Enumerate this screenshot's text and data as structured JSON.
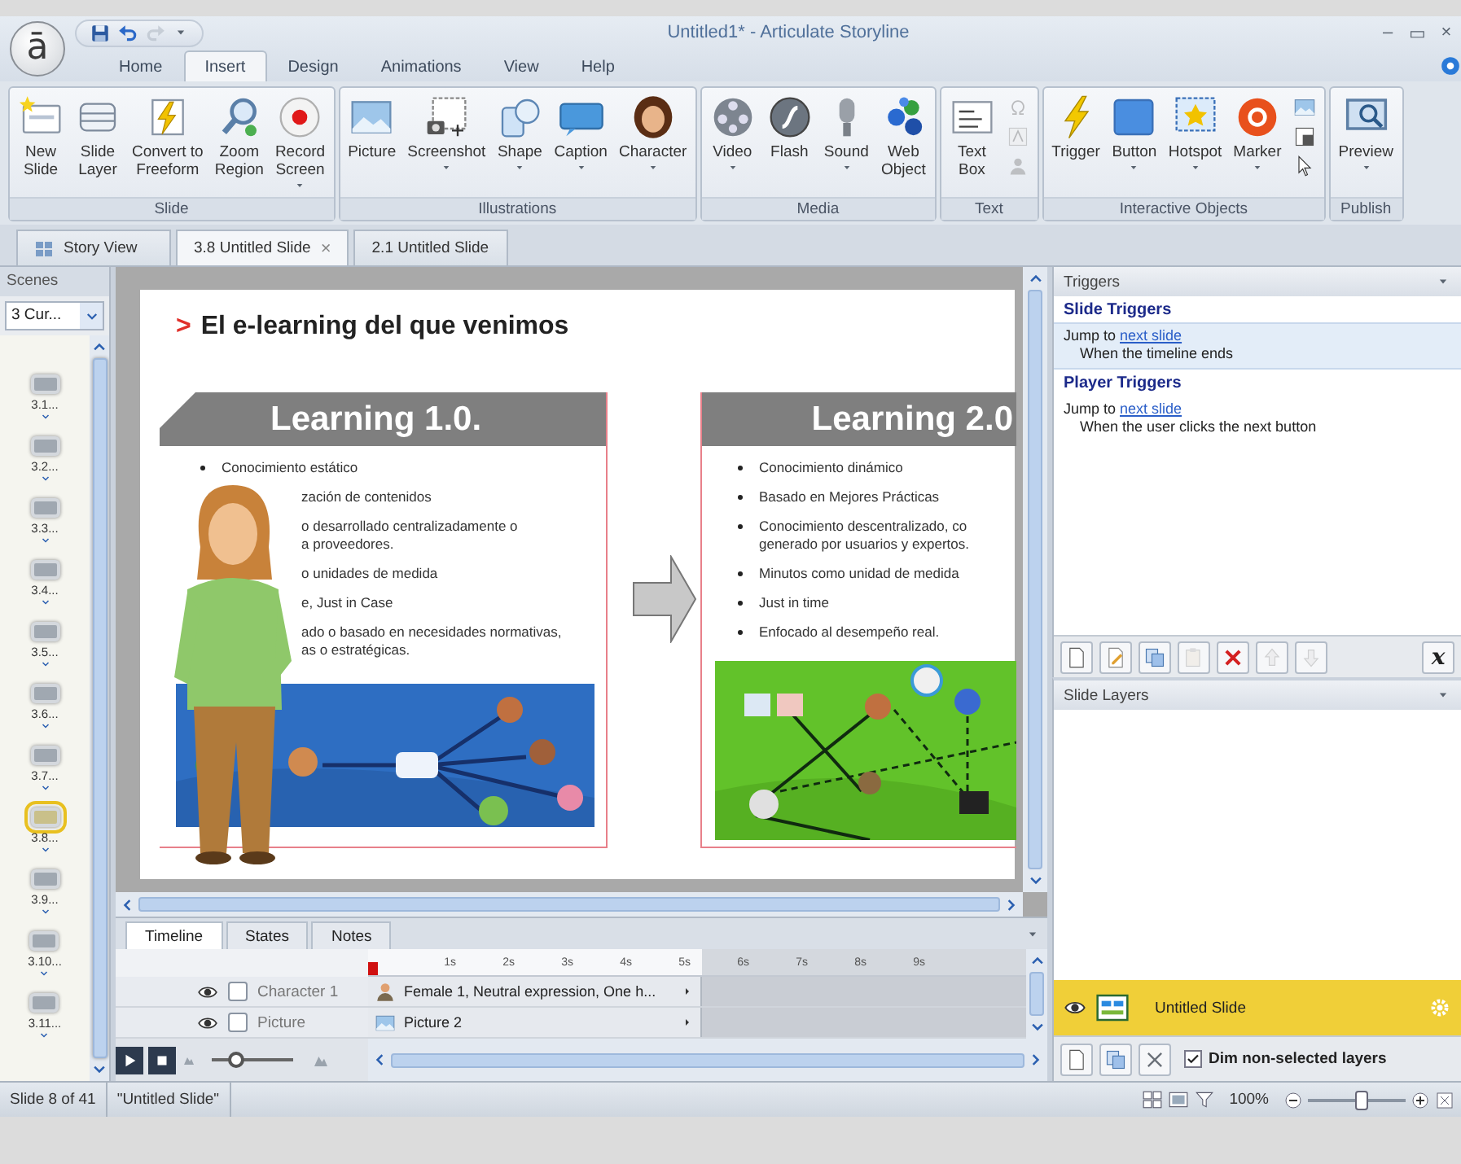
{
  "app_button": "ā",
  "quick_access": [
    {
      "kind": "save",
      "disabled": false
    },
    {
      "kind": "undo",
      "disabled": false
    },
    {
      "kind": "redo",
      "disabled": true
    },
    {
      "kind": "customize",
      "disabled": false
    }
  ],
  "window": {
    "title": "Untitled1* - Articulate Storyline",
    "controls": [
      "–",
      "▭",
      "×"
    ]
  },
  "ribbon_tabs": [
    {
      "label": "Home",
      "selected": false
    },
    {
      "label": "Insert",
      "selected": true
    },
    {
      "label": "Design",
      "selected": false
    },
    {
      "label": "Animations",
      "selected": false
    },
    {
      "label": "View",
      "selected": false
    },
    {
      "label": "Help",
      "selected": false
    }
  ],
  "ribbon_groups": [
    {
      "label": "Slide",
      "buttons": [
        {
          "kind": "new-slide",
          "label": "New\nSlide",
          "dropdown": false
        },
        {
          "kind": "slide-layer",
          "label": "Slide\nLayer",
          "dropdown": false
        },
        {
          "kind": "convert",
          "label": "Convert to\nFreeform",
          "dropdown": false
        },
        {
          "kind": "zoom",
          "label": "Zoom\nRegion",
          "dropdown": false
        },
        {
          "kind": "record",
          "label": "Record\nScreen",
          "dropdown": true
        }
      ]
    },
    {
      "label": "Illustrations",
      "buttons": [
        {
          "kind": "picture",
          "label": "Picture",
          "dropdown": false
        },
        {
          "kind": "screenshot",
          "label": "Screenshot",
          "dropdown": true
        },
        {
          "kind": "shape",
          "label": "Shape",
          "dropdown": true
        },
        {
          "kind": "caption",
          "label": "Caption",
          "dropdown": true
        },
        {
          "kind": "character",
          "label": "Character",
          "dropdown": true
        }
      ]
    },
    {
      "label": "Media",
      "buttons": [
        {
          "kind": "video",
          "label": "Video",
          "dropdown": true
        },
        {
          "kind": "flash",
          "label": "Flash",
          "dropdown": false
        },
        {
          "kind": "sound",
          "label": "Sound",
          "dropdown": true
        },
        {
          "kind": "web",
          "label": "Web\nObject",
          "dropdown": false
        }
      ]
    },
    {
      "label": "Text",
      "buttons": [
        {
          "kind": "textbox",
          "label": "Text\nBox",
          "dropdown": false
        }
      ],
      "small_tools": [
        {
          "kind": "symbol",
          "disabled": true
        },
        {
          "kind": "textstyle",
          "disabled": true
        },
        {
          "kind": "user",
          "disabled": true
        }
      ]
    },
    {
      "label": "Interactive Objects",
      "buttons": [
        {
          "kind": "trigger",
          "label": "Trigger",
          "dropdown": false
        },
        {
          "kind": "button",
          "label": "Button",
          "dropdown": true
        },
        {
          "kind": "hotspot",
          "label": "Hotspot",
          "dropdown": true
        },
        {
          "kind": "marker",
          "label": "Marker",
          "dropdown": true
        }
      ],
      "small_tools": [
        {
          "kind": "picture",
          "disabled": false
        },
        {
          "kind": "state",
          "disabled": false
        },
        {
          "kind": "cursor",
          "disabled": false
        }
      ]
    },
    {
      "label": "Publish",
      "buttons": [
        {
          "kind": "preview",
          "label": "Preview",
          "dropdown": true
        }
      ]
    }
  ],
  "doc_tabs": [
    {
      "kind": "story",
      "label": "Story View",
      "selected": false
    },
    {
      "kind": "slide",
      "label": "3.8 Untitled Slide",
      "selected": true,
      "close": "×"
    },
    {
      "kind": "slide",
      "label": "2.1 Untitled Slide",
      "selected": false
    }
  ],
  "scenes": {
    "title": "Scenes",
    "dropdown": "3 Cur...",
    "slides": [
      {
        "label": "3.1...",
        "selected": false
      },
      {
        "label": "3.2...",
        "selected": false
      },
      {
        "label": "3.3...",
        "selected": false
      },
      {
        "label": "3.4...",
        "selected": false
      },
      {
        "label": "3.5...",
        "selected": false
      },
      {
        "label": "3.6...",
        "selected": false
      },
      {
        "label": "3.7...",
        "selected": false
      },
      {
        "label": "3.8...",
        "selected": true
      },
      {
        "label": "3.9...",
        "selected": false
      },
      {
        "label": "3.10...",
        "selected": false
      },
      {
        "label": "3.11...",
        "selected": false
      }
    ]
  },
  "slide": {
    "title_marker": ">",
    "title": "El e-learning del que venimos",
    "cards": [
      {
        "title": "Learning 1.0.",
        "picture": {
          "kind": "picture"
        },
        "bullets": [
          {
            "text": "Conocimiento estático",
            "covered": false
          },
          {
            "text": "zación de contenidos",
            "covered": true
          },
          {
            "text": "o desarrollado centralizadamente o\na proveedores.",
            "covered": true
          },
          {
            "text": "o unidades de medida",
            "covered": true
          },
          {
            "text": "e, Just in Case",
            "covered": true
          },
          {
            "text": "ado o basado en necesidades normativas,\nas o estratégicas.",
            "covered": true
          }
        ]
      },
      {
        "title": "Learning 2.0",
        "picture": {
          "kind": "picture"
        },
        "bullets": [
          {
            "text": "Conocimiento dinámico",
            "covered": false
          },
          {
            "text": "Basado en Mejores Prácticas",
            "covered": false
          },
          {
            "text": "Conocimiento descentralizado, co\ngenerado por usuarios y expertos.",
            "covered": false
          },
          {
            "text": "Minutos como unidad de medida",
            "covered": false
          },
          {
            "text": "Just in time",
            "covered": false
          },
          {
            "text": "Enfocado al desempeño real.",
            "covered": false
          }
        ]
      }
    ],
    "character": {
      "kind": "picture"
    }
  },
  "timeline": {
    "tabs": [
      {
        "label": "Timeline",
        "selected": true
      },
      {
        "label": "States",
        "selected": false
      },
      {
        "label": "Notes",
        "selected": false
      }
    ],
    "ruler": [
      "1s",
      "2s",
      "3s",
      "4s",
      "5s",
      "6s",
      "7s",
      "8s",
      "9s"
    ],
    "rows": [
      {
        "kind": "character",
        "name": "Character 1",
        "item": "Female 1, Neutral expression, One h...",
        "locked": false
      },
      {
        "kind": "picture",
        "name": "Picture",
        "item": "Picture 2",
        "locked": false
      }
    ],
    "zoom": {
      "level": 0.3
    }
  },
  "triggers": {
    "title": "Triggers",
    "sections": [
      {
        "title": "Slide Triggers",
        "items": [
          {
            "action": "Jump to",
            "target": "next slide",
            "condition": "When the timeline ends",
            "selected": true
          }
        ]
      },
      {
        "title": "Player Triggers",
        "items": [
          {
            "action": "Jump to",
            "target": "next slide",
            "condition": "When the user clicks the next button",
            "selected": false
          }
        ]
      }
    ],
    "tools": [
      {
        "kind": "new",
        "disabled": false
      },
      {
        "kind": "edit",
        "disabled": false
      },
      {
        "kind": "copy",
        "disabled": false
      },
      {
        "kind": "paste",
        "disabled": true
      },
      {
        "kind": "delete",
        "disabled": false
      },
      {
        "kind": "up",
        "disabled": true
      },
      {
        "kind": "down",
        "disabled": true
      }
    ],
    "variables": "x"
  },
  "layers": {
    "title": "Slide Layers",
    "items": [
      {
        "name": "Untitled Slide",
        "selected": true
      }
    ],
    "tools": [
      {
        "kind": "new",
        "disabled": false
      },
      {
        "kind": "copy",
        "disabled": false
      },
      {
        "kind": "remove",
        "disabled": false
      }
    ],
    "dim": {
      "label": "Dim non-selected layers",
      "checked": true
    }
  },
  "status": {
    "slide": "Slide 8 of 41",
    "name": "\"Untitled Slide\"",
    "zoom": "100%",
    "zoom_slider": {
      "level": 0.55
    }
  }
}
